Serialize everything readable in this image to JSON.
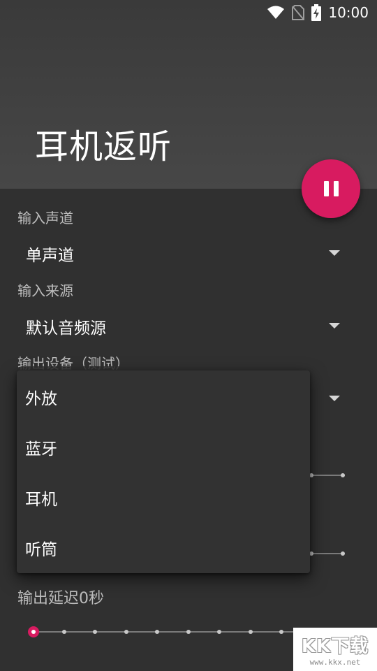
{
  "status_bar": {
    "time": "10:00",
    "icons": [
      "wifi-icon",
      "no-sim-icon",
      "battery-charging-icon"
    ]
  },
  "app_bar": {
    "title": "耳机返听",
    "fab_icon": "pause-icon"
  },
  "settings": {
    "input_channel": {
      "label": "输入声道",
      "value": "单声道"
    },
    "input_source": {
      "label": "输入来源",
      "value": "默认音频源"
    },
    "output_device": {
      "label": "输出设备（测试）",
      "value": "外放"
    },
    "output_delay": {
      "label": "输出延迟0秒",
      "level": 0
    }
  },
  "dropdown_menu": {
    "items": [
      "外放",
      "蓝牙",
      "耳机",
      "听筒"
    ]
  },
  "watermark": {
    "main": "KK下载",
    "sub": "www.kkx.net"
  },
  "colors": {
    "accent": "#d81b60",
    "background": "#303030",
    "appbar": "#474747"
  }
}
